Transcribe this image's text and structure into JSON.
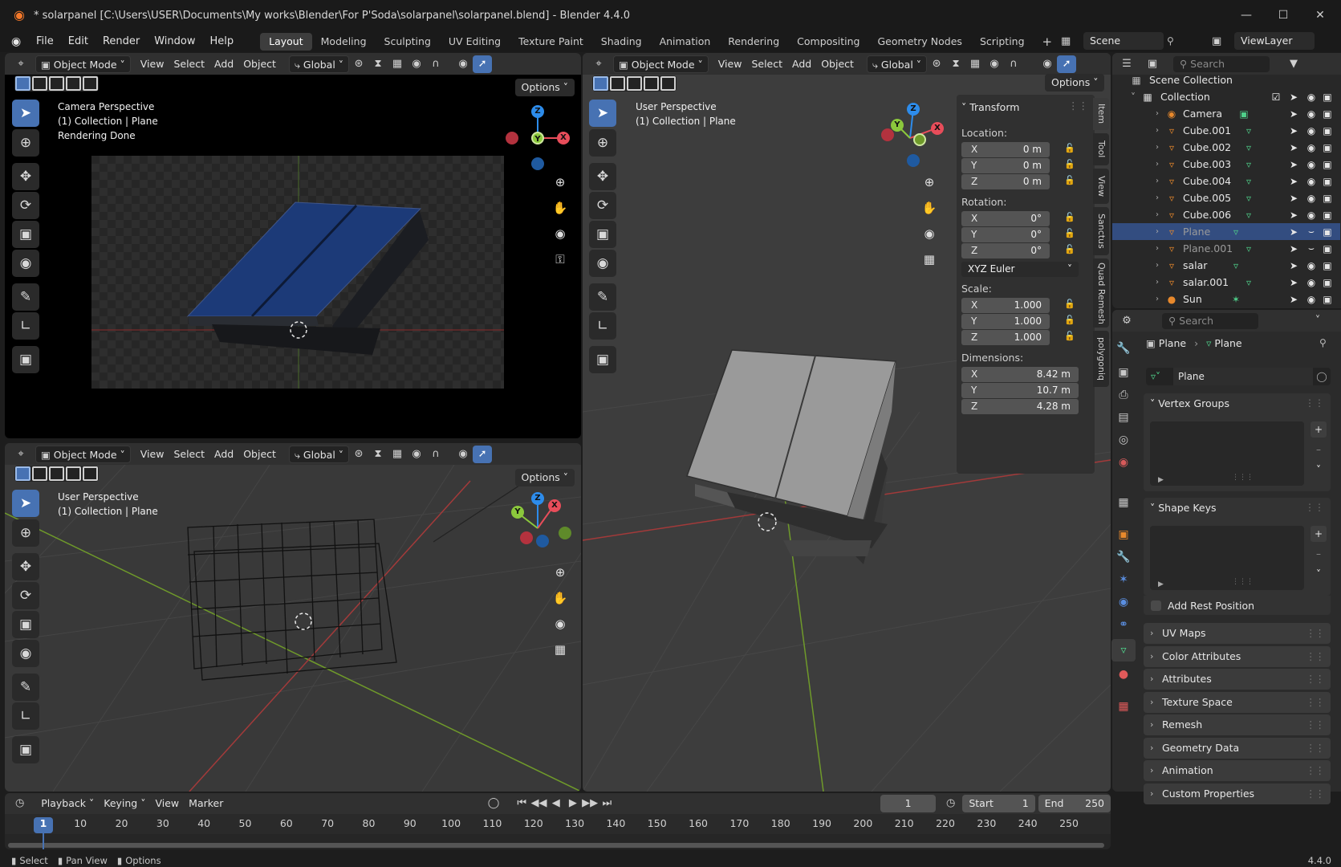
{
  "app": {
    "title": "* solarpanel [C:\\Users\\USER\\Documents\\My works\\Blender\\For P'Soda\\solarpanel\\solarpanel.blend] - Blender 4.4.0",
    "version": "4.4.0"
  },
  "menu": [
    "File",
    "Edit",
    "Render",
    "Window",
    "Help"
  ],
  "workspaces": [
    "Layout",
    "Modeling",
    "Sculpting",
    "UV Editing",
    "Texture Paint",
    "Shading",
    "Animation",
    "Rendering",
    "Compositing",
    "Geometry Nodes",
    "Scripting"
  ],
  "active_workspace": "Layout",
  "scene": "Scene",
  "view_layer": "ViewLayer",
  "viewport_header": {
    "mode": "Object Mode",
    "view": "View",
    "select": "Select",
    "add": "Add",
    "object": "Object",
    "orientation": "Global",
    "options": "Options"
  },
  "viewports": {
    "top_left": {
      "line1": "Camera Perspective",
      "line2": "(1) Collection | Plane",
      "line3": "Rendering Done"
    },
    "bottom_left": {
      "line1": "User Perspective",
      "line2": "(1) Collection | Plane"
    },
    "right": {
      "line1": "User Perspective",
      "line2": "(1) Collection | Plane"
    }
  },
  "gizmo": {
    "z": "Z",
    "y": "Y",
    "x": "X"
  },
  "transform": {
    "title": "Transform",
    "location_label": "Location:",
    "rotation_label": "Rotation:",
    "scale_label": "Scale:",
    "dimensions_label": "Dimensions:",
    "location": [
      {
        "axis": "X",
        "value": "0 m"
      },
      {
        "axis": "Y",
        "value": "0 m"
      },
      {
        "axis": "Z",
        "value": "0 m"
      }
    ],
    "rotation": [
      {
        "axis": "X",
        "value": "0°"
      },
      {
        "axis": "Y",
        "value": "0°"
      },
      {
        "axis": "Z",
        "value": "0°"
      }
    ],
    "rotation_mode": "XYZ Euler",
    "scale": [
      {
        "axis": "X",
        "value": "1.000"
      },
      {
        "axis": "Y",
        "value": "1.000"
      },
      {
        "axis": "Z",
        "value": "1.000"
      }
    ],
    "dimensions": [
      {
        "axis": "X",
        "value": "8.42 m"
      },
      {
        "axis": "Y",
        "value": "10.7 m"
      },
      {
        "axis": "Z",
        "value": "4.28 m"
      }
    ]
  },
  "npanel_tabs": [
    "Item",
    "Tool",
    "View",
    "Sanctus",
    "Quad Remesh",
    "polygoniq"
  ],
  "outliner": {
    "search_placeholder": "Search",
    "scene_collection": "Scene Collection",
    "collection": "Collection",
    "items": [
      {
        "name": "Camera",
        "type": "camera"
      },
      {
        "name": "Cube.001",
        "type": "mesh"
      },
      {
        "name": "Cube.002",
        "type": "mesh"
      },
      {
        "name": "Cube.003",
        "type": "mesh"
      },
      {
        "name": "Cube.004",
        "type": "mesh"
      },
      {
        "name": "Cube.005",
        "type": "mesh"
      },
      {
        "name": "Cube.006",
        "type": "mesh"
      },
      {
        "name": "Plane",
        "type": "mesh",
        "selected": true,
        "dim": true
      },
      {
        "name": "Plane.001",
        "type": "mesh",
        "dim": true
      },
      {
        "name": "salar",
        "type": "mesh"
      },
      {
        "name": "salar.001",
        "type": "mesh"
      },
      {
        "name": "Sun",
        "type": "light"
      }
    ]
  },
  "properties": {
    "search_placeholder": "Search",
    "breadcrumb": [
      "Plane",
      "Plane"
    ],
    "mesh_name": "Plane",
    "vertex_groups": "Vertex Groups",
    "shape_keys": "Shape Keys",
    "add_rest_position": "Add Rest Position",
    "panels": [
      "UV Maps",
      "Color Attributes",
      "Attributes",
      "Texture Space",
      "Remesh",
      "Geometry Data",
      "Animation",
      "Custom Properties"
    ]
  },
  "timeline": {
    "playback": "Playback",
    "keying": "Keying",
    "view": "View",
    "marker": "Marker",
    "current_frame": "1",
    "start_label": "Start",
    "start": "1",
    "end_label": "End",
    "end": "250",
    "ticks": [
      "1",
      "10",
      "20",
      "30",
      "40",
      "50",
      "60",
      "70",
      "80",
      "90",
      "100",
      "110",
      "120",
      "130",
      "140",
      "150",
      "160",
      "170",
      "180",
      "190",
      "200",
      "210",
      "220",
      "230",
      "240",
      "250"
    ]
  },
  "statusbar": {
    "select": "Select",
    "pan_view": "Pan View",
    "options": "Options"
  },
  "colors": {
    "accent": "#4772b3",
    "x_axis": "#e84d5a",
    "y_axis": "#8bc83c",
    "z_axis": "#2d8ceb",
    "selection_row": "#334d80"
  }
}
